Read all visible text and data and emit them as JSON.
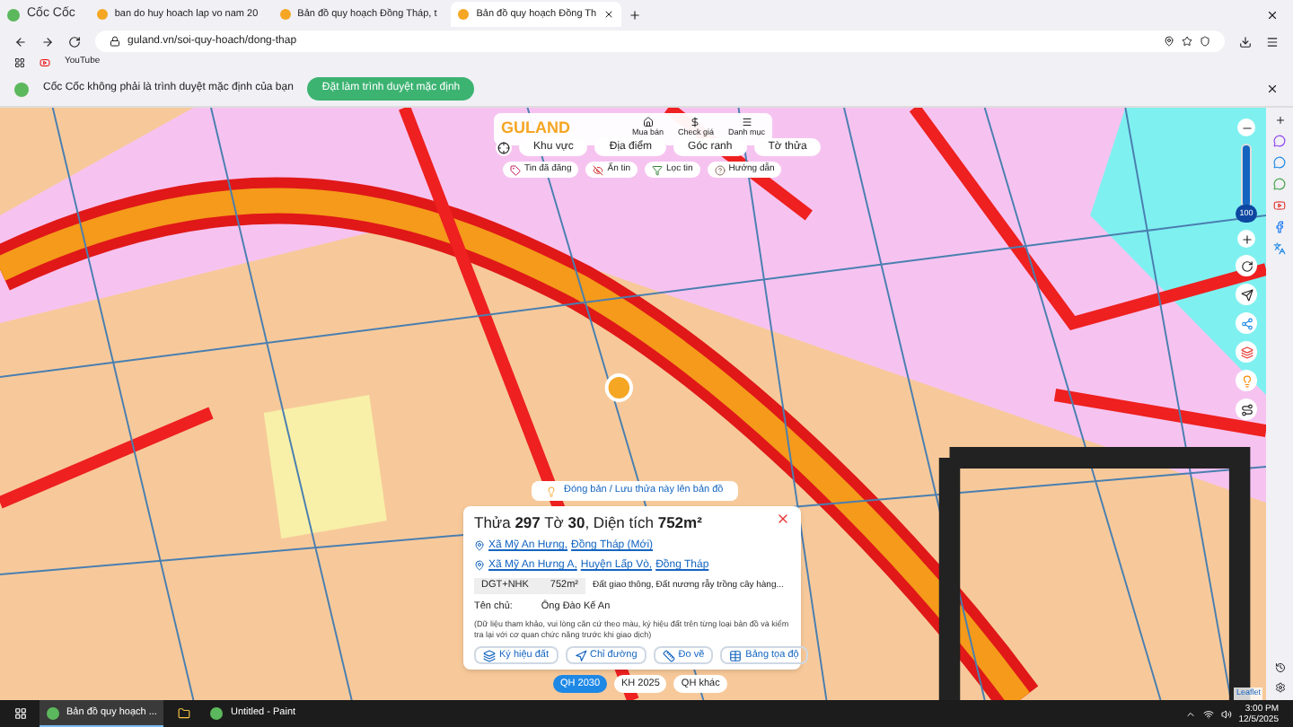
{
  "browser": {
    "brand": "Cốc Cốc",
    "tabs": [
      {
        "title": "ban do huy hoach lap vo nam 20",
        "selected": false
      },
      {
        "title": "Bản đồ quy hoạch Đồng Tháp, t",
        "selected": false
      },
      {
        "title": "Bản đồ quy hoạch Đồng Th",
        "selected": true
      }
    ],
    "url": "guland.vn/soi-quy-hoach/dong-thap",
    "bookmarks": [
      "YouTube"
    ],
    "notice": {
      "text": "Cốc Cốc không phải là trình duyệt mặc định của bạn",
      "button": "Đặt làm trình duyệt mặc định"
    }
  },
  "map": {
    "header": {
      "logo": "GULAND",
      "links": [
        "Mua bán",
        "Check giá",
        "Danh mục"
      ],
      "modes": [
        {
          "label": "Khu vực",
          "selected": false
        },
        {
          "label": "Địa điểm",
          "selected": false
        },
        {
          "label": "Góc ranh",
          "selected": false
        },
        {
          "label": "Tờ thửa",
          "selected": false
        }
      ],
      "filters": [
        "Tin đã đăng",
        "Ẩn tin",
        "Lọc tin",
        "Hướng dẫn"
      ]
    },
    "zoom": {
      "reading": "100",
      "level": 1
    },
    "save_button": "Đóng bản / Lưu thửa này lên bản đồ",
    "popup": {
      "title": "Thửa **297** Tờ **30**, Diện tích **752m²**",
      "addresses": [
        [
          "Xã Mỹ An Hưng,",
          "Đồng Tháp (Mới)"
        ],
        [
          "Xã Mỹ An Hưng A,",
          "Huyện Lấp Vò,",
          "Đồng Tháp"
        ]
      ],
      "land": {
        "code": "DGT+NHK",
        "area": "752m²",
        "description": "Đất giao thông, Đất nương rẫy trồng cây hàng..."
      },
      "owner_label": "Tên chủ:",
      "owner": "Ông Đào Kế An",
      "note": "(Dữ liệu tham khảo, vui lòng căn cứ theo màu, ký hiệu đất trên từng loại bản đồ và kiểm tra lại với cơ quan chức năng trước khi giao dịch)",
      "actions": [
        "Ký hiệu đất",
        "Chỉ đường",
        "Đo vẽ",
        "Bảng tọa độ"
      ]
    },
    "layers": [
      {
        "label": "QH 2030",
        "selected": true
      },
      {
        "label": "KH 2025",
        "selected": false
      },
      {
        "label": "QH khác",
        "selected": false
      }
    ],
    "attribution": "Leaflet"
  },
  "taskbar": {
    "apps": [
      {
        "title": "Bản đồ quy hoạch ...",
        "selected": true
      },
      {
        "title": "Untitled - Paint",
        "selected": false
      }
    ],
    "time": "3:00 PM",
    "date": "12/5/2025"
  }
}
